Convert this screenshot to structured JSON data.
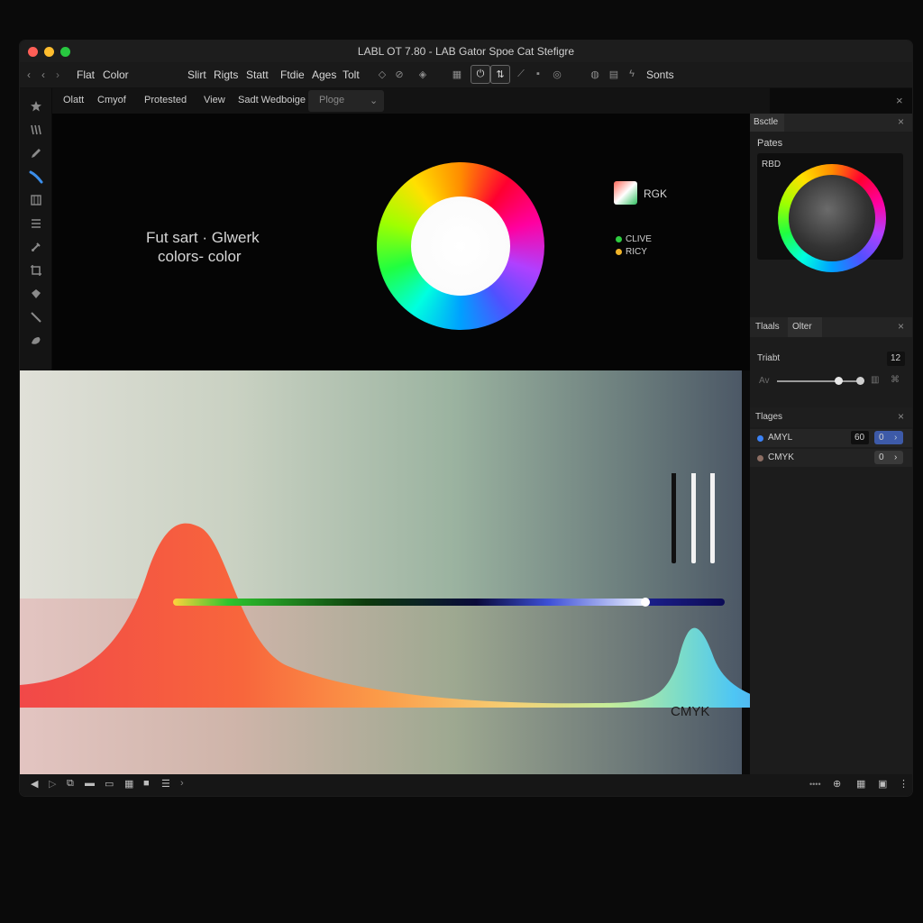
{
  "window": {
    "title": "LABL OT 7.80 - LAB Gator Spoe Cat Stefigre",
    "traffic_colors": [
      "#ff5f57",
      "#ffbd2e",
      "#28c840"
    ]
  },
  "menubar": {
    "nav_back": "‹",
    "nav_fwd": "‹",
    "nav_more": "›",
    "items": [
      "Flat",
      "Color",
      "Slirt",
      "Rigts",
      "Statt",
      "Ftdie",
      "Ages",
      "Tolt"
    ],
    "sonts": "Sonts"
  },
  "tabs": {
    "items": [
      "Olatt",
      "Cmyof",
      "Protested",
      "View",
      "Sadt Wedboige",
      "Ploge"
    ],
    "dropdown_caret": "⌄",
    "close": "×"
  },
  "canvas": {
    "caption_line1": "Fut sart · Glwerk",
    "caption_line2": "colors- color",
    "swatch_label": "RGK",
    "legend": [
      {
        "label": "CLIVE",
        "color": "#2ecc40"
      },
      {
        "label": "RICY",
        "color": "#f0b429"
      }
    ]
  },
  "spectrum": {
    "label": "CMYK",
    "slider_value": 0.82
  },
  "sidebar": {
    "panel1": {
      "tab": "Bsctle",
      "close": "×",
      "section": "Pates",
      "preview_label": "RBD"
    },
    "panel2": {
      "tabs": [
        "Tlaals",
        "Olter"
      ],
      "close": "×",
      "field_label": "Triabt",
      "field_value": "12",
      "slider_label": "Av",
      "slider_value": 0.9
    },
    "panel3": {
      "title": "Tlages",
      "close": "×",
      "rows": [
        {
          "name": "AMYL",
          "value": "60",
          "chip": "0",
          "color": "#3b82f6"
        },
        {
          "name": "CMYK",
          "value": "",
          "chip": "0",
          "color": "#8d6e63"
        }
      ]
    }
  },
  "statusbar": {
    "dots": "••••"
  }
}
